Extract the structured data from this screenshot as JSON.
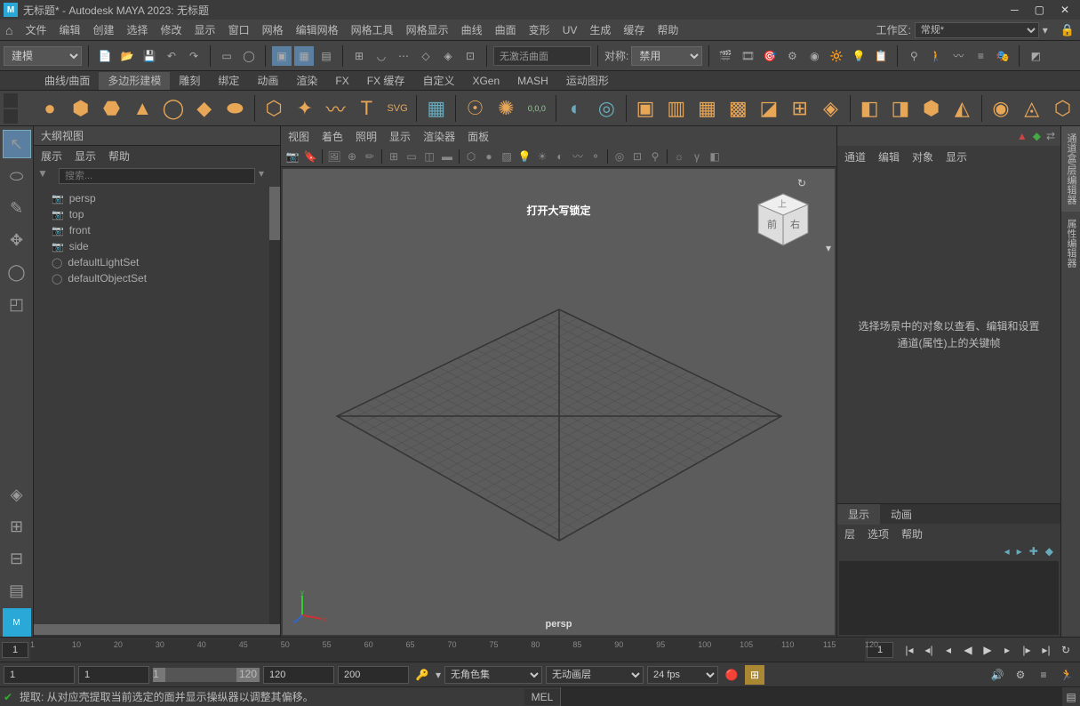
{
  "title": "无标题* - Autodesk MAYA 2023: 无标题",
  "menu": [
    "文件",
    "编辑",
    "创建",
    "选择",
    "修改",
    "显示",
    "窗口",
    "网格",
    "编辑网格",
    "网格工具",
    "网格显示",
    "曲线",
    "曲面",
    "变形",
    "UV",
    "生成",
    "缓存",
    "帮助"
  ],
  "workspace_label": "工作区:",
  "workspace_value": "常规*",
  "module_select": "建模",
  "activation_text": "无激活曲面",
  "sym_label": "对称:",
  "sym_value": "禁用",
  "shelf_tabs": [
    "曲线/曲面",
    "多边形建模",
    "雕刻",
    "绑定",
    "动画",
    "渲染",
    "FX",
    "FX 缓存",
    "自定义",
    "XGen",
    "MASH",
    "运动图形"
  ],
  "shelf_active": 1,
  "outliner": {
    "title": "大纲视图",
    "menu": [
      "展示",
      "显示",
      "帮助"
    ],
    "search_placeholder": "搜索...",
    "nodes": [
      {
        "type": "cam",
        "label": "persp"
      },
      {
        "type": "cam",
        "label": "top"
      },
      {
        "type": "cam",
        "label": "front"
      },
      {
        "type": "cam",
        "label": "side"
      },
      {
        "type": "set",
        "label": "defaultLightSet"
      },
      {
        "type": "set",
        "label": "defaultObjectSet"
      }
    ]
  },
  "viewport": {
    "menu": [
      "视图",
      "着色",
      "照明",
      "显示",
      "渲染器",
      "面板"
    ],
    "caption": "打开大写锁定",
    "camera": "persp"
  },
  "channelbox": {
    "tabs": [
      "通道",
      "编辑",
      "对象",
      "显示"
    ],
    "empty_text": "选择场景中的对象以查看、编辑和设置通道(属性)上的关键帧",
    "layer_tabs": [
      "显示",
      "动画"
    ],
    "layer_active": 0,
    "layer_menu": [
      "层",
      "选项",
      "帮助"
    ]
  },
  "vtabs": [
    "通道盒/层编辑器",
    "属性编辑器"
  ],
  "timeline": {
    "current": "1",
    "ticks": [
      1,
      10,
      20,
      30,
      40,
      45,
      50,
      55,
      60,
      65,
      70,
      75,
      80,
      85,
      90,
      95,
      100,
      105,
      110,
      115,
      120
    ],
    "end_current": "1"
  },
  "range": {
    "start": "1",
    "in": "1",
    "slider_in": "1",
    "slider_out": "120",
    "out": "120",
    "end": "200",
    "char_set": "无角色集",
    "anim_layer": "无动画层",
    "fps": "24 fps"
  },
  "cmd": {
    "help": "提取: 从对应壳提取当前选定的面并显示操纵器以调整其偏移。",
    "lang": "MEL"
  },
  "cube_faces": {
    "front": "前",
    "right": "右",
    "top": "上"
  }
}
